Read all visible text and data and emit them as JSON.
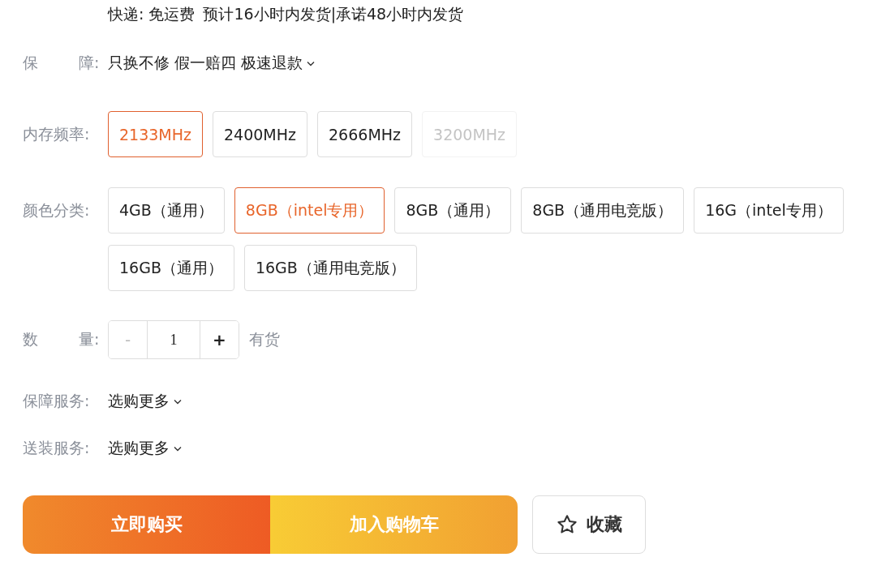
{
  "shipping": {
    "method": "快递: 免运费",
    "promise": "预计16小时内发货|承诺48小时内发货"
  },
  "guarantee": {
    "label": "保 障:",
    "value": "只换不修 假一赔四 极速退款"
  },
  "frequency": {
    "label": "内存频率:",
    "options": [
      {
        "label": "2133MHz",
        "selected": true,
        "disabled": false
      },
      {
        "label": "2400MHz",
        "selected": false,
        "disabled": false
      },
      {
        "label": "2666MHz",
        "selected": false,
        "disabled": false
      },
      {
        "label": "3200MHz",
        "selected": false,
        "disabled": true
      }
    ]
  },
  "color_category": {
    "label": "颜色分类:",
    "options": [
      {
        "label": "4GB（通用）",
        "selected": false,
        "disabled": false
      },
      {
        "label": "8GB（intel专用）",
        "selected": true,
        "disabled": false
      },
      {
        "label": "8GB（通用）",
        "selected": false,
        "disabled": false
      },
      {
        "label": "8GB（通用电竞版）",
        "selected": false,
        "disabled": false
      },
      {
        "label": "16G（intel专用）",
        "selected": false,
        "disabled": false
      },
      {
        "label": "16GB（通用）",
        "selected": false,
        "disabled": false
      },
      {
        "label": "16GB（通用电竞版）",
        "selected": false,
        "disabled": false
      }
    ]
  },
  "quantity": {
    "label": "数 量:",
    "minus": "-",
    "value": "1",
    "plus": "+",
    "minus_disabled": true,
    "stock": "有货"
  },
  "services": [
    {
      "label": "保障服务:",
      "value": "选购更多"
    },
    {
      "label": "送装服务:",
      "value": "选购更多"
    }
  ],
  "actions": {
    "buy": "立即购买",
    "cart": "加入购物车",
    "favorite": "收藏"
  }
}
